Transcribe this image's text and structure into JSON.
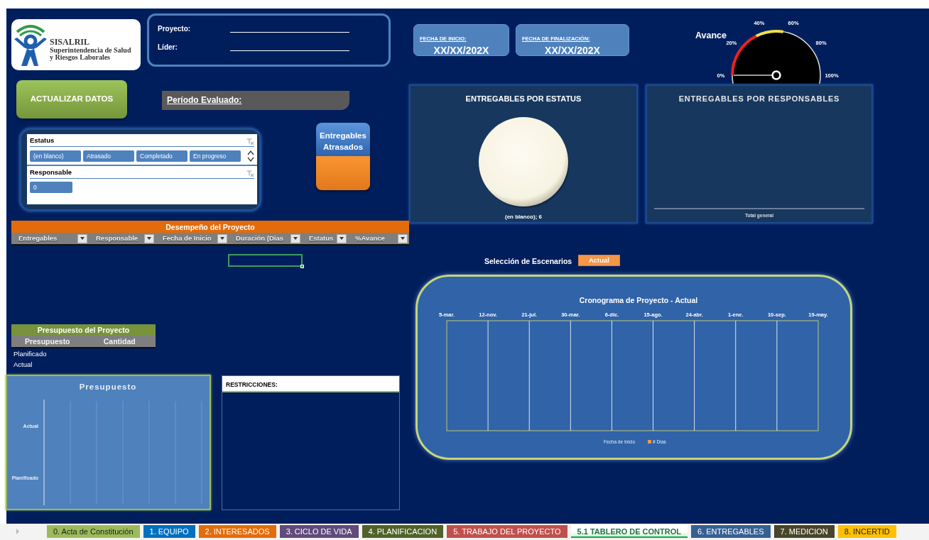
{
  "logo": {
    "name": "SISALRIL",
    "lines": [
      "Superintendencia de Salud",
      "y Riesgos Laborales"
    ]
  },
  "project_box": {
    "fields": [
      {
        "label": "Proyecto:"
      },
      {
        "label": "Líder:"
      }
    ]
  },
  "dates": [
    {
      "label": "FECHA DE INICIO:",
      "value": "XX/XX/202X"
    },
    {
      "label": "FECHA DE FINALIZACIÓN:",
      "value": "XX/XX/202X"
    }
  ],
  "gauge": {
    "title": "Avance",
    "ticks": [
      "0%",
      "20%",
      "40%",
      "60%",
      "80%",
      "100%"
    ]
  },
  "update_button": {
    "label": "ACTUALIZAR DATOS"
  },
  "period": {
    "label": "Período Evaluado:"
  },
  "slicers": [
    {
      "title": "Estatus",
      "scrollable": true,
      "items": [
        {
          "label": "(en blanco)",
          "selected": true
        },
        {
          "label": "Atrasado",
          "selected": true
        },
        {
          "label": "Completado",
          "selected": true
        },
        {
          "label": "En progreso",
          "selected": true
        }
      ]
    },
    {
      "title": "Responsable",
      "scrollable": false,
      "items": [
        {
          "label": "0",
          "selected": true
        }
      ]
    }
  ],
  "late_button": {
    "label": "Entregables Atrasados"
  },
  "status_chart": {
    "title": "ENTREGABLES POR ESTATUS",
    "slice_labels": [
      "(en blanco); 6"
    ]
  },
  "responsible_chart": {
    "title": "ENTREGABLES POR RESPONSABLES",
    "axis_labels": [
      "Total general"
    ]
  },
  "performance_table": {
    "title": "Desempeño del Proyecto",
    "columns": [
      "Entregables",
      "Responsable",
      "Fecha de Inicio",
      "Duración (Días",
      "Estatus",
      "%Avance"
    ]
  },
  "cell_cursor": true,
  "scenario": {
    "label": "Selección de Escenarios",
    "value": "Actual"
  },
  "schedule_chart": {
    "title": "Cronograma de Proyecto - Actual",
    "date_labels": [
      "5-mar.",
      "12-nov.",
      "21-jul.",
      "30-mar.",
      "6-dic.",
      "15-ago.",
      "24-abr.",
      "1-ene.",
      "10-sep.",
      "19-may."
    ],
    "legend": [
      {
        "name": "Fecha de Inicio"
      },
      {
        "name": "# Días",
        "color": "#f79646"
      }
    ]
  },
  "budget_table": {
    "title": "Presupuesto del Proyecto",
    "columns": [
      "Presupuesto",
      "Cantidad"
    ],
    "rows": [
      "Planificado",
      "Actual"
    ]
  },
  "budget_chart": {
    "title": "Presupuesto",
    "row_labels": [
      "Actual",
      "Planificado"
    ]
  },
  "restrictions": {
    "title": "RESTRICCIONES:"
  },
  "sheet_tabs": [
    {
      "label": "0. Acta de Constitución",
      "color": "#9bbb59",
      "selected": false
    },
    {
      "label": "1. EQUIPO",
      "color": "#0070c0",
      "selected": false
    },
    {
      "label": "2. INTERESADOS",
      "color": "#e46c0a",
      "selected": false
    },
    {
      "label": "3. CICLO DE VIDA",
      "color": "#604a7b",
      "selected": false
    },
    {
      "label": "4. PLANIFICACION",
      "color": "#4f6228",
      "selected": false
    },
    {
      "label": "5. TRABAJO DEL PROYECTO",
      "color": "#c0504d",
      "selected": false
    },
    {
      "label": "5.1 TABLERO DE CONTROL",
      "color": "#00b050",
      "selected": true
    },
    {
      "label": "6. ENTREGABLES",
      "color": "#366092",
      "selected": false
    },
    {
      "label": "7. MEDICION",
      "color": "#494529",
      "selected": false
    },
    {
      "label": "8. INCERTID",
      "color": "#ffc000",
      "selected": false
    }
  ]
}
